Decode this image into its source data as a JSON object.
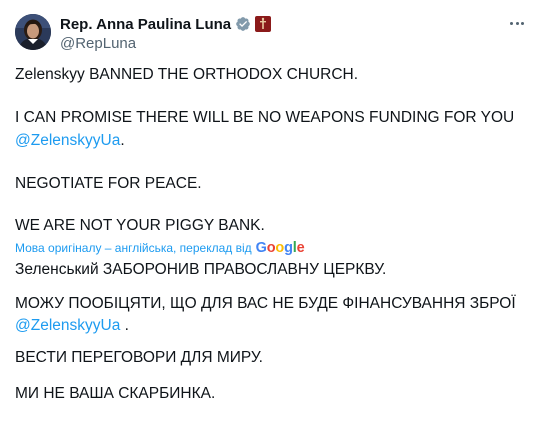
{
  "author": {
    "display_name": "Rep. Anna Paulina Luna",
    "handle": "@RepLuna",
    "verified_icon": "verified-badge-icon",
    "affiliation_icon": "congress-seal-icon"
  },
  "menu": {
    "icon": "more-horizontal-icon"
  },
  "tweet": {
    "line1": "Zelenskyy BANNED THE ORTHODOX CHURCH.",
    "line2": "I CAN PROMISE THERE WILL BE NO WEAPONS FUNDING FOR YOU",
    "mention": "@ZelenskyyUa",
    "mention_suffix": ".",
    "line4": "NEGOTIATE FOR PEACE.",
    "line5": "WE ARE NOT YOUR PIGGY BANK."
  },
  "translation": {
    "note": "Мова оригіналу – англійська, переклад від",
    "brand": "Google",
    "line1": "Зеленський ЗАБОРОНИВ ПРАВОСЛАВНУ ЦЕРКВУ.",
    "line2": "МОЖУ ПООБІЦЯТИ, ЩО ДЛЯ ВАС НЕ БУДЕ ФІНАНСУВАННЯ ЗБРОЇ",
    "mention": "@ZelenskyyUa",
    "mention_suffix": " .",
    "line4": "ВЕСТИ ПЕРЕГОВОРИ ДЛЯ МИРУ.",
    "line5": "МИ НЕ ВАША СКАРБИНКА."
  },
  "colors": {
    "text": "#0f1419",
    "secondary": "#536471",
    "link": "#1d9bf0",
    "google_blue": "#4285f4",
    "google_red": "#ea4335",
    "google_yellow": "#fbbc05",
    "google_green": "#34a853"
  }
}
